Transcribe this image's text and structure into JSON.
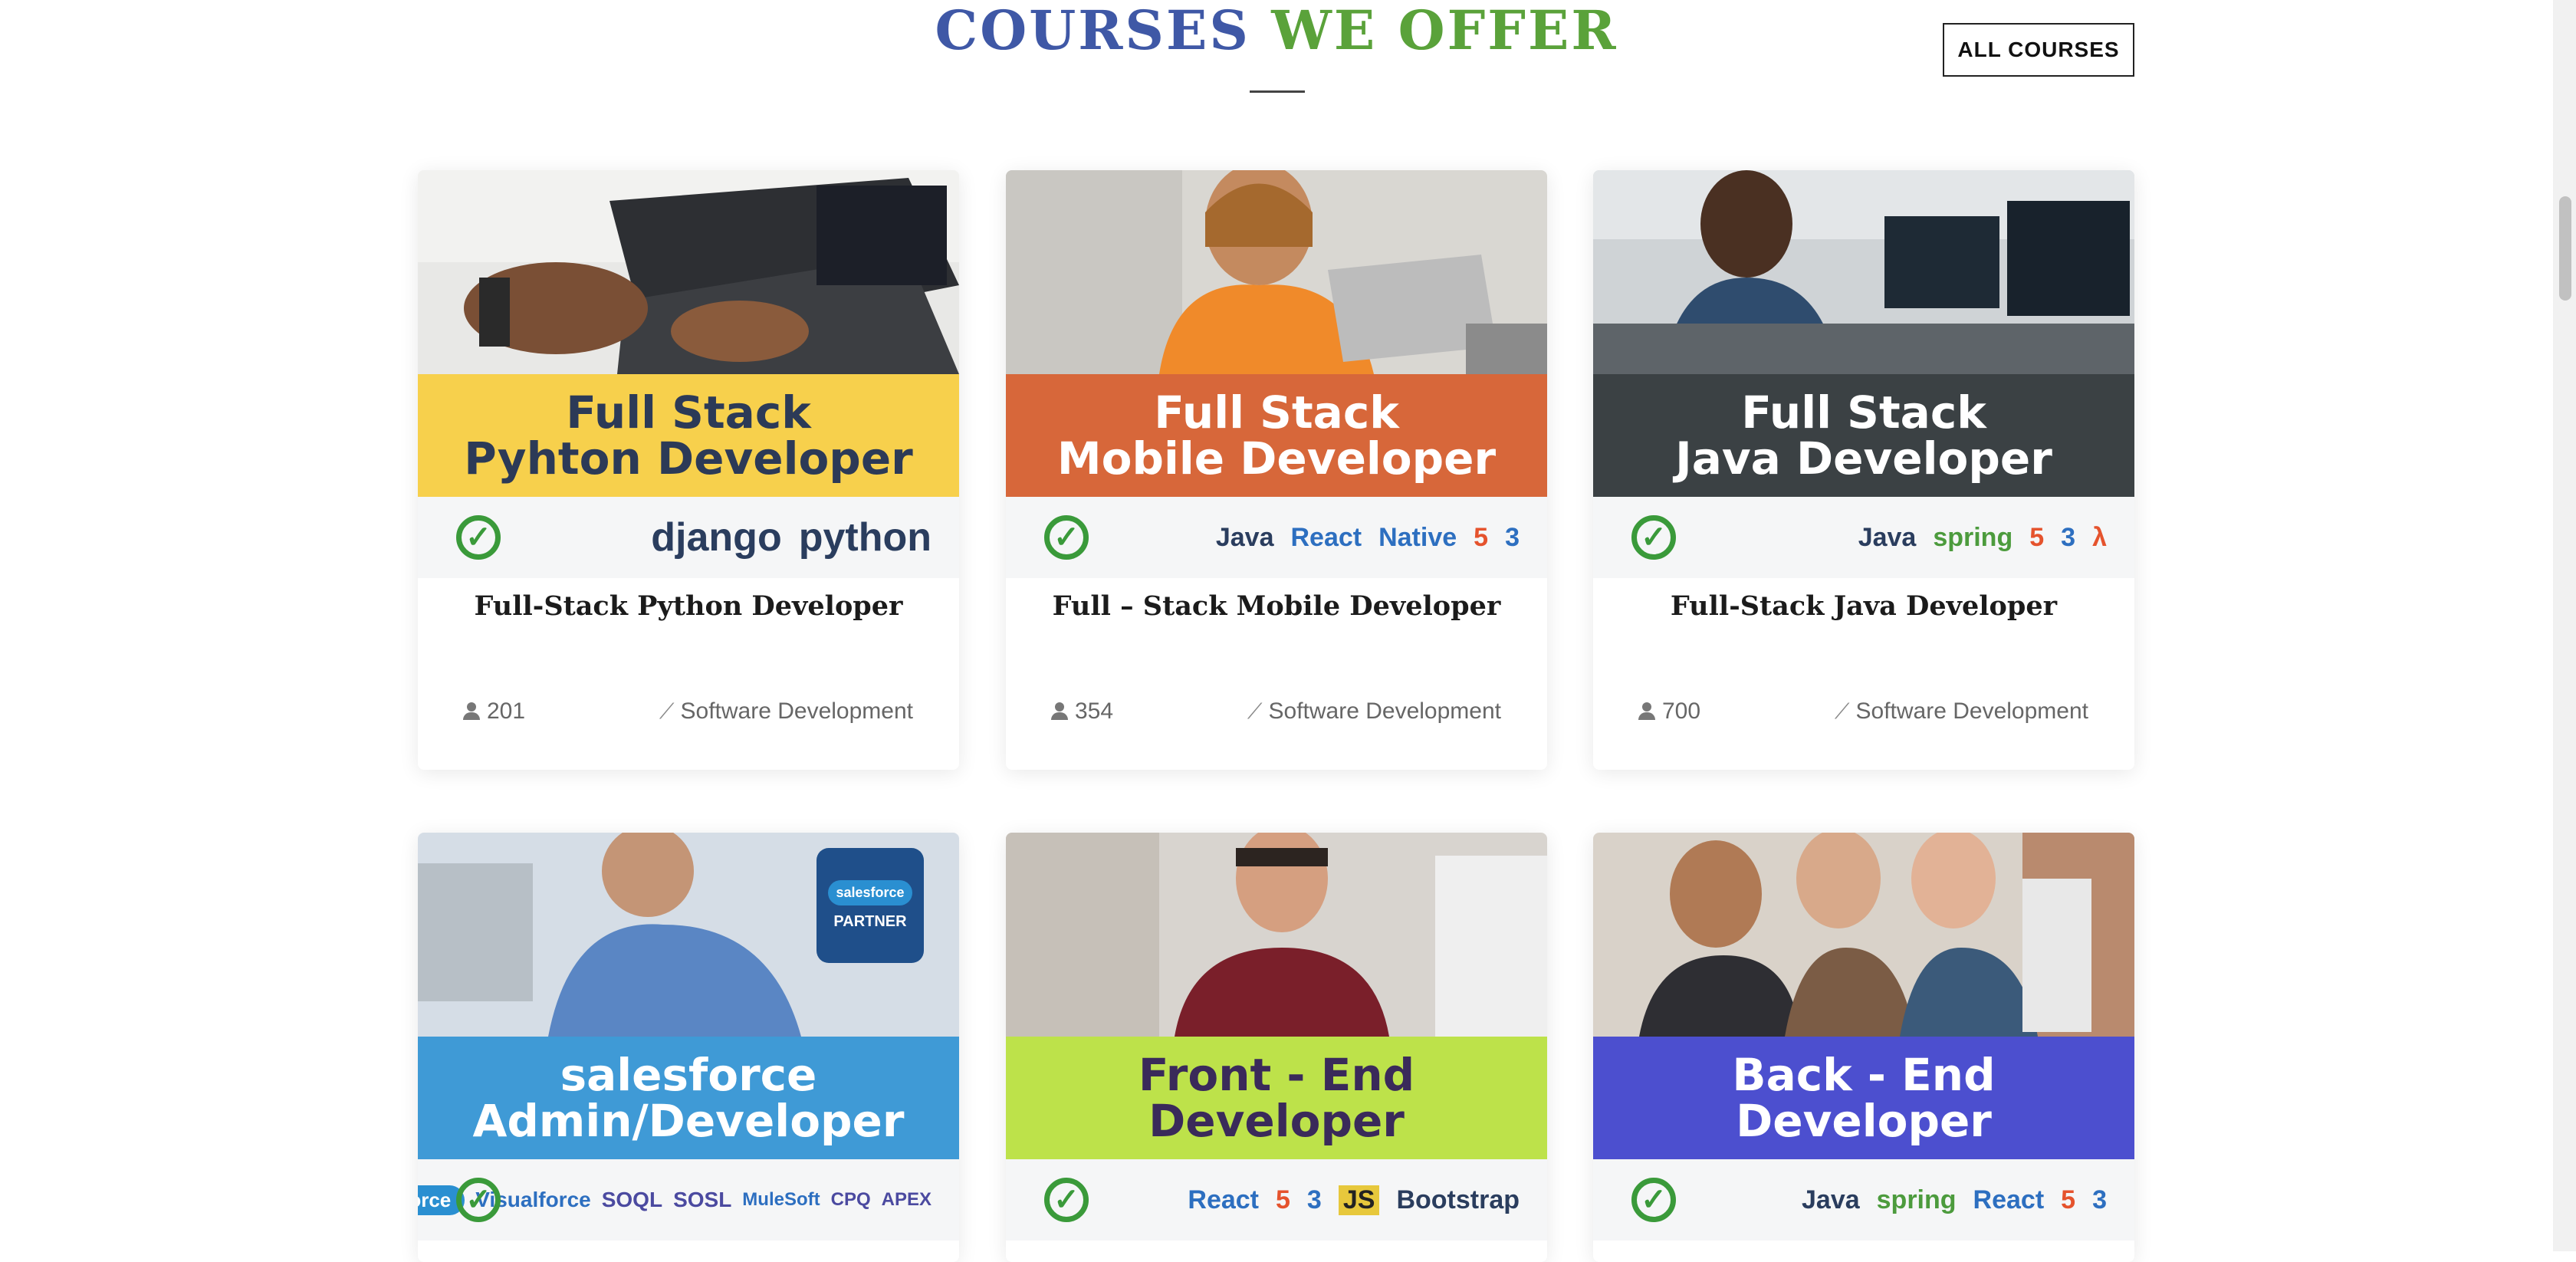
{
  "header": {
    "title_word1": "COURSES",
    "title_word2": "WE OFFER",
    "all_courses_label": "ALL COURSES"
  },
  "courses": [
    {
      "title": "Full-Stack Python Developer",
      "students": "201",
      "category": "Software Development",
      "image": {
        "band_lines": [
          "Full Stack",
          "Pyhton Developer"
        ],
        "band_color": "#f7d04c",
        "band_text_color": "#2c3a57",
        "logos": [
          "django",
          "python"
        ]
      }
    },
    {
      "title": "Full – Stack Mobile Developer",
      "students": "354",
      "category": "Software Development",
      "image": {
        "band_lines": [
          "Full Stack",
          "Mobile Developer"
        ],
        "band_color": "#d7673a",
        "band_text_color": "#ffffff",
        "logos": [
          "Java",
          "React",
          "Native",
          "5",
          "3"
        ]
      }
    },
    {
      "title": "Full-Stack Java Developer",
      "students": "700",
      "category": "Software Development",
      "image": {
        "band_lines": [
          "Full Stack",
          "Java Developer"
        ],
        "band_color": "#3b4144",
        "band_text_color": "#ffffff",
        "logos": [
          "Java",
          "spring",
          "5",
          "3",
          "λ"
        ]
      }
    },
    {
      "title": "",
      "students": "",
      "category": "",
      "image": {
        "band_lines": [
          "salesforce",
          "Admin/Developer"
        ],
        "band_color": "#3f9ad6",
        "band_text_color": "#ffffff",
        "badge": [
          "salesforce",
          "PARTNER"
        ],
        "logos": [
          "salesforce",
          "Visualforce",
          "SOQL",
          "SOSL",
          "MuleSoft",
          "CPQ",
          "APEX"
        ]
      }
    },
    {
      "title": "",
      "students": "",
      "category": "",
      "image": {
        "band_lines": [
          "Front - End",
          "Developer"
        ],
        "band_color": "#bde24a",
        "band_text_color": "#3a2a5a",
        "logos": [
          "React",
          "5",
          "3",
          "JS",
          "Bootstrap"
        ]
      }
    },
    {
      "title": "",
      "students": "",
      "category": "",
      "image": {
        "band_lines": [
          "Back - End",
          "Developer"
        ],
        "band_color": "#4c4fcf",
        "band_text_color": "#ffffff",
        "logos": [
          "Java",
          "spring",
          "React",
          "5",
          "3"
        ]
      }
    }
  ]
}
